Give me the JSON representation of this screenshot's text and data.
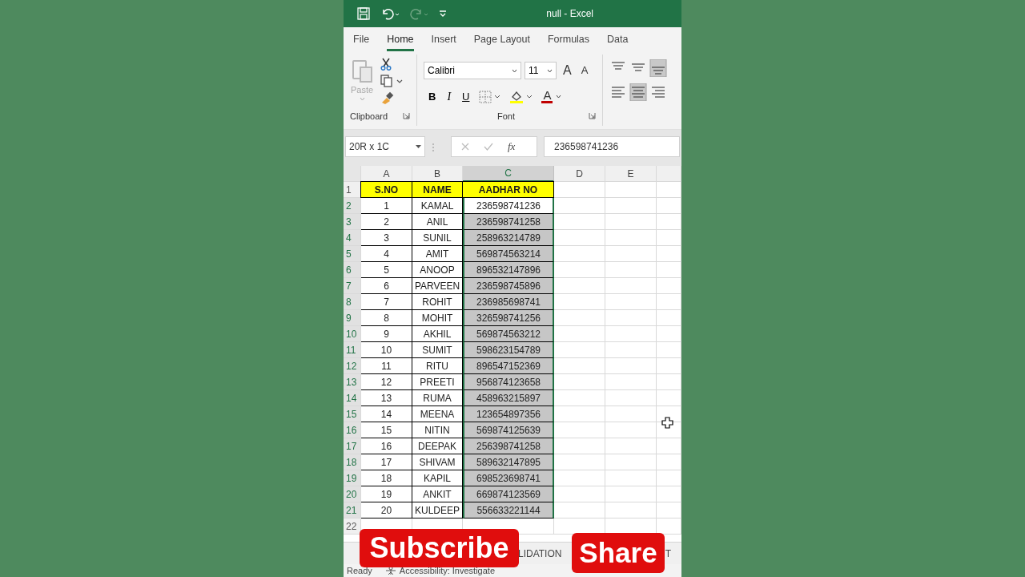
{
  "window": {
    "title": "null - Excel"
  },
  "quick_access": [
    {
      "kind": "save",
      "disabled": false
    },
    {
      "kind": "undo",
      "disabled": false
    },
    {
      "kind": "redo",
      "disabled": true
    },
    {
      "kind": "customize",
      "disabled": false
    }
  ],
  "ribbon_tabs": [
    {
      "label": "File",
      "selected": false
    },
    {
      "label": "Home",
      "selected": true
    },
    {
      "label": "Insert",
      "selected": false
    },
    {
      "label": "Page Layout",
      "selected": false
    },
    {
      "label": "Formulas",
      "selected": false
    },
    {
      "label": "Data",
      "selected": false
    }
  ],
  "clipboard": {
    "paste_label": "Paste",
    "paste_disabled": true,
    "group_label": "Clipboard"
  },
  "font": {
    "font_name": "Calibri",
    "font_size": "11",
    "grow": "A",
    "shrink": "A",
    "bold": "B",
    "italic": "I",
    "underline": "U",
    "font_color": "A",
    "group_label": "Font"
  },
  "alignment_buttons": [
    {
      "kind": "top",
      "selected": false
    },
    {
      "kind": "middle",
      "selected": false
    },
    {
      "kind": "bottom",
      "selected": true
    },
    {
      "kind": "left",
      "selected": false
    },
    {
      "kind": "center",
      "selected": true
    },
    {
      "kind": "right",
      "selected": false
    }
  ],
  "formula_bar": {
    "name_box": "20R x 1C",
    "fx": "fx",
    "value": "236598741236"
  },
  "columns": [
    {
      "label": "A",
      "selected": false
    },
    {
      "label": "B",
      "selected": false
    },
    {
      "label": "C",
      "selected": true
    },
    {
      "label": "D",
      "selected": false
    },
    {
      "label": "E",
      "selected": false
    }
  ],
  "header_row": {
    "row": "1",
    "cells": [
      "S.NO",
      "NAME",
      "AADHAR NO"
    ]
  },
  "rows": [
    {
      "row": "2",
      "sno": "1",
      "name": "KAMAL",
      "aadhar": "236598741236",
      "selected": true,
      "active": true
    },
    {
      "row": "3",
      "sno": "2",
      "name": "ANIL",
      "aadhar": "236598741258",
      "selected": true,
      "active": false
    },
    {
      "row": "4",
      "sno": "3",
      "name": "SUNIL",
      "aadhar": "258963214789",
      "selected": true,
      "active": false
    },
    {
      "row": "5",
      "sno": "4",
      "name": "AMIT",
      "aadhar": "569874563214",
      "selected": true,
      "active": false
    },
    {
      "row": "6",
      "sno": "5",
      "name": "ANOOP",
      "aadhar": "896532147896",
      "selected": true,
      "active": false
    },
    {
      "row": "7",
      "sno": "6",
      "name": "PARVEEN",
      "aadhar": "236598745896",
      "selected": true,
      "active": false
    },
    {
      "row": "8",
      "sno": "7",
      "name": "ROHIT",
      "aadhar": "236985698741",
      "selected": true,
      "active": false
    },
    {
      "row": "9",
      "sno": "8",
      "name": "MOHIT",
      "aadhar": "326598741256",
      "selected": true,
      "active": false
    },
    {
      "row": "10",
      "sno": "9",
      "name": "AKHIL",
      "aadhar": "569874563212",
      "selected": true,
      "active": false
    },
    {
      "row": "11",
      "sno": "10",
      "name": "SUMIT",
      "aadhar": "598623154789",
      "selected": true,
      "active": false
    },
    {
      "row": "12",
      "sno": "11",
      "name": "RITU",
      "aadhar": "896547152369",
      "selected": true,
      "active": false
    },
    {
      "row": "13",
      "sno": "12",
      "name": "PREETI",
      "aadhar": "956874123658",
      "selected": true,
      "active": false
    },
    {
      "row": "14",
      "sno": "13",
      "name": "RUMA",
      "aadhar": "458963215897",
      "selected": true,
      "active": false
    },
    {
      "row": "15",
      "sno": "14",
      "name": "MEENA",
      "aadhar": "123654897356",
      "selected": true,
      "active": false
    },
    {
      "row": "16",
      "sno": "15",
      "name": "NITIN",
      "aadhar": "569874125639",
      "selected": true,
      "active": false
    },
    {
      "row": "17",
      "sno": "16",
      "name": "DEEPAK",
      "aadhar": "256398741258",
      "selected": true,
      "active": false
    },
    {
      "row": "18",
      "sno": "17",
      "name": "SHIVAM",
      "aadhar": "589632147895",
      "selected": true,
      "active": false
    },
    {
      "row": "19",
      "sno": "18",
      "name": "KAPIL",
      "aadhar": "698523698741",
      "selected": true,
      "active": false
    },
    {
      "row": "20",
      "sno": "19",
      "name": "ANKIT",
      "aadhar": "669874123569",
      "selected": true,
      "active": false
    },
    {
      "row": "21",
      "sno": "20",
      "name": "KULDEEP",
      "aadhar": "556633221144",
      "selected": true,
      "active": false
    }
  ],
  "empty_rows": [
    "22"
  ],
  "sheet_tabs": [
    "LIDATION",
    "T"
  ],
  "status_bar": {
    "ready": "Ready",
    "accessibility": "Accessibility: Investigate"
  },
  "overlay_buttons": [
    {
      "kind": "subscribe",
      "label": "Subscribe"
    },
    {
      "kind": "share",
      "label": "Share"
    }
  ]
}
